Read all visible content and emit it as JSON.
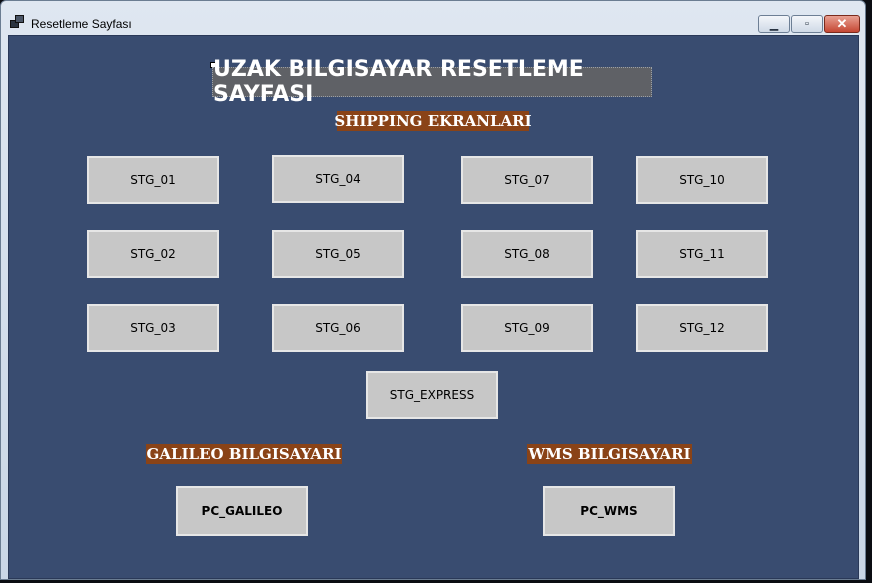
{
  "window": {
    "title": "Resetleme Sayfası",
    "minimize_symbol": "▁",
    "maximize_symbol": "▫",
    "close_symbol": "✕"
  },
  "page": {
    "title": "UZAK BILGISAYAR RESETLEME SAYFASI"
  },
  "sections": {
    "shipping": "SHIPPING EKRANLARI",
    "galileo": "GALILEO BILGISAYARI",
    "wms": "WMS BILGISAYARI"
  },
  "buttons": {
    "stg_01": "STG_01",
    "stg_02": "STG_02",
    "stg_03": "STG_03",
    "stg_04": "STG_04",
    "stg_05": "STG_05",
    "stg_06": "STG_06",
    "stg_07": "STG_07",
    "stg_08": "STG_08",
    "stg_09": "STG_09",
    "stg_10": "STG_10",
    "stg_11": "STG_11",
    "stg_12": "STG_12",
    "stg_express": "STG_EXPRESS",
    "pc_galileo": "PC_GALILEO",
    "pc_wms": "PC_WMS"
  },
  "colors": {
    "form_background": "#394c70",
    "section_label_background": "#8a4317",
    "title_background": "#5f6166",
    "button_background": "#c7c7c7"
  },
  "icons": {
    "app": "window-app-icon",
    "minimize": "minimize-icon",
    "maximize": "maximize-icon",
    "close": "close-icon"
  }
}
